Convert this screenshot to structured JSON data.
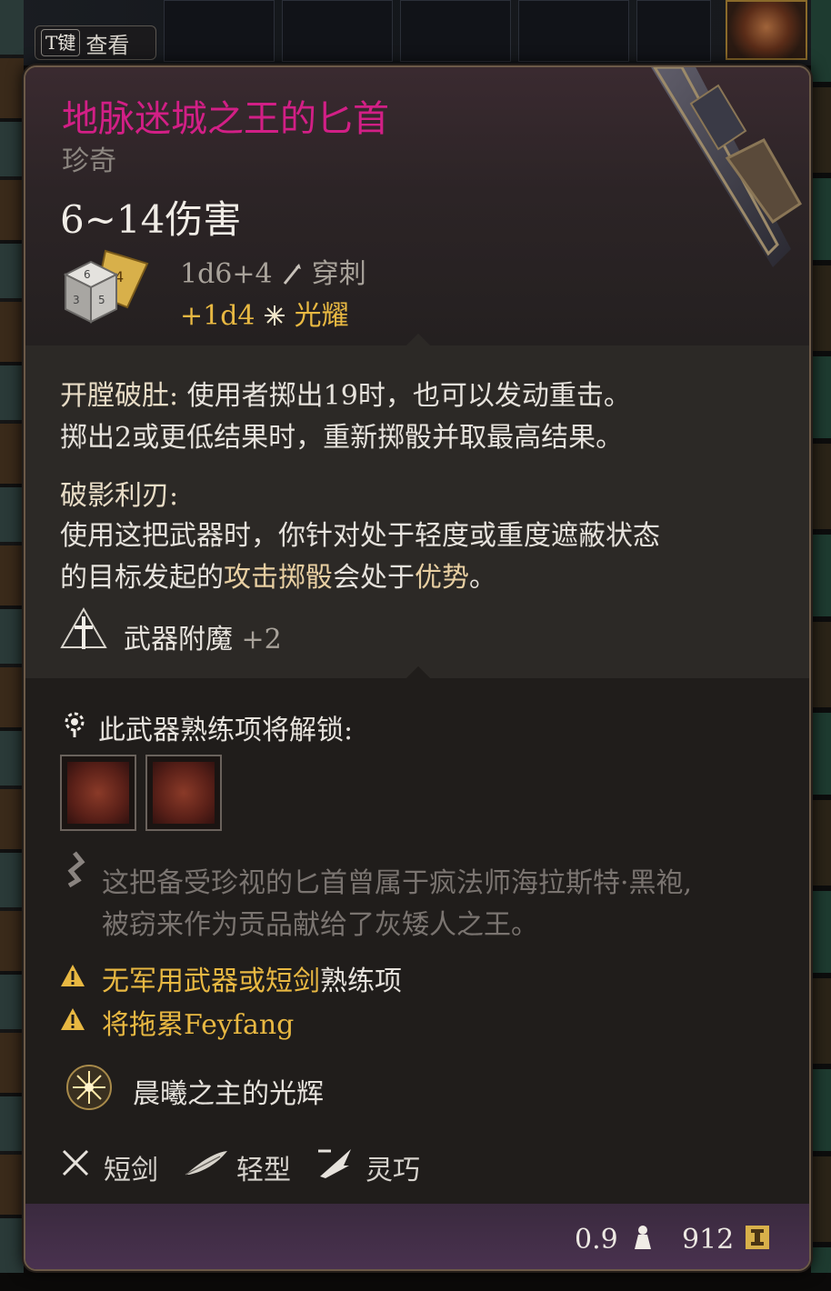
{
  "hint": {
    "key": "T键",
    "label": "查看"
  },
  "item": {
    "name": "地脉迷城之王的匕首",
    "rarity": "珍奇",
    "damage_range": "6~14伤害",
    "damage_lines": [
      {
        "dice": "1d6+4",
        "type": "穿刺"
      },
      {
        "dice": "+1d4",
        "type": "光耀"
      }
    ]
  },
  "abilities": [
    {
      "title": "开膛破肚:",
      "line1": " 使用者掷出19时，也可以发动重击。",
      "line2": "掷出2或更低结果时，重新掷骰并取最高结果。"
    },
    {
      "title": "破影利刃:",
      "line1": "使用这把武器时，你针对处于轻度或重度遮蔽状态",
      "line2_a": "的目标发起的",
      "line2_hl": "攻击掷骰",
      "line2_b": "会处于",
      "line2_hl2": "优势",
      "line2_c": "。"
    }
  ],
  "enchant": {
    "label": "武器附魔",
    "value": "+2"
  },
  "proficiency": {
    "label": "此武器熟练项将解锁:"
  },
  "lore": {
    "line1": "这把备受珍视的匕首曾属于疯法师海拉斯特·黑袍,",
    "line2": "被窃来作为贡品献给了灰矮人之王。"
  },
  "warnings": [
    {
      "text_a": "无军用武器或短剑",
      "text_b": "熟练项"
    },
    {
      "text": "将拖累Feyfang"
    }
  ],
  "spell": {
    "label": "晨曦之主的光辉"
  },
  "properties": [
    {
      "icon": "crossed-swords-icon",
      "label": "短剑"
    },
    {
      "icon": "feather-icon",
      "label": "轻型"
    },
    {
      "icon": "dexterity-icon",
      "label": "灵巧"
    }
  ],
  "footer": {
    "weight": "0.9",
    "price": "912"
  },
  "colors": {
    "rarity_name": "#d21f86",
    "gold": "#e8b842",
    "text": "#e6e2dc",
    "muted": "#7a7470"
  }
}
